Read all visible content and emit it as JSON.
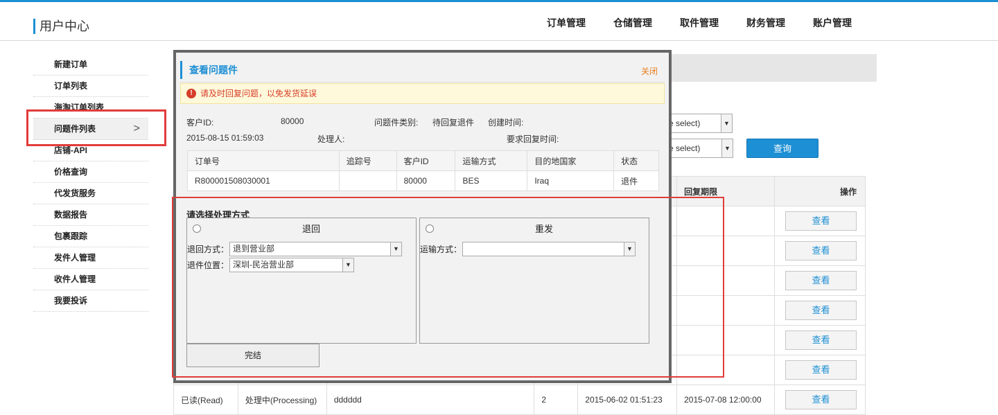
{
  "header": {
    "brand": "用户中心",
    "nav": [
      "订单管理",
      "仓储管理",
      "取件管理",
      "财务管理",
      "账户管理"
    ]
  },
  "sidebar": {
    "items": [
      "新建订单",
      "订单列表",
      "海淘订单列表",
      "问题件列表",
      "店铺-API",
      "价格查询",
      "代发货服务",
      "数据报告",
      "包裹跟踪",
      "发件人管理",
      "收件人管理",
      "我要投诉"
    ],
    "active_chevron": ">"
  },
  "filters": {
    "select1": "e select)",
    "select2": "e select)",
    "query_label": "查询"
  },
  "bg_table": {
    "headers": {
      "reply_deadline": "回复期限",
      "actions": "操作"
    },
    "view_label": "查看",
    "last_row": [
      "已读(Read)",
      "处理中(Processing)",
      "dddddd",
      "2",
      "2015-06-02 01:51:23",
      "2015-07-08 12:00:00"
    ]
  },
  "modal": {
    "title": "查看问题件",
    "close_label": "关闭",
    "warning": "请及时回复问题，以免发货延误",
    "customer_id_label": "客户ID:",
    "customer_id_value": "80000",
    "issue_type_label": "问题件类别:",
    "issue_type_value": "待回复退件",
    "created_time_label": "创建时间:",
    "created_time_value": "2015-08-15 01:59:03",
    "handler_label": "处理人:",
    "required_reply_label": "要求回复时间:",
    "table": {
      "headers": [
        "订单号",
        "追踪号",
        "客户ID",
        "运输方式",
        "目的地国家",
        "状态"
      ],
      "row": [
        "R800001508030001",
        "",
        "80000",
        "BES",
        "Iraq",
        "退件"
      ]
    },
    "choose_label": "请选择处理方式",
    "return_panel": {
      "title": "退回",
      "method_label": "退回方式：",
      "method_value": "退到营业部",
      "location_label": "退件位置：",
      "location_value": "深圳-民治营业部"
    },
    "resend_panel": {
      "title": "重发",
      "shipping_label": "运输方式：",
      "shipping_value": ""
    },
    "done_label": "完结"
  },
  "colors": {
    "accent": "#1d8fd4",
    "highlight_box": "#e23b3b",
    "close_link": "#e87c1e",
    "warning_text": "#d63e2a"
  }
}
